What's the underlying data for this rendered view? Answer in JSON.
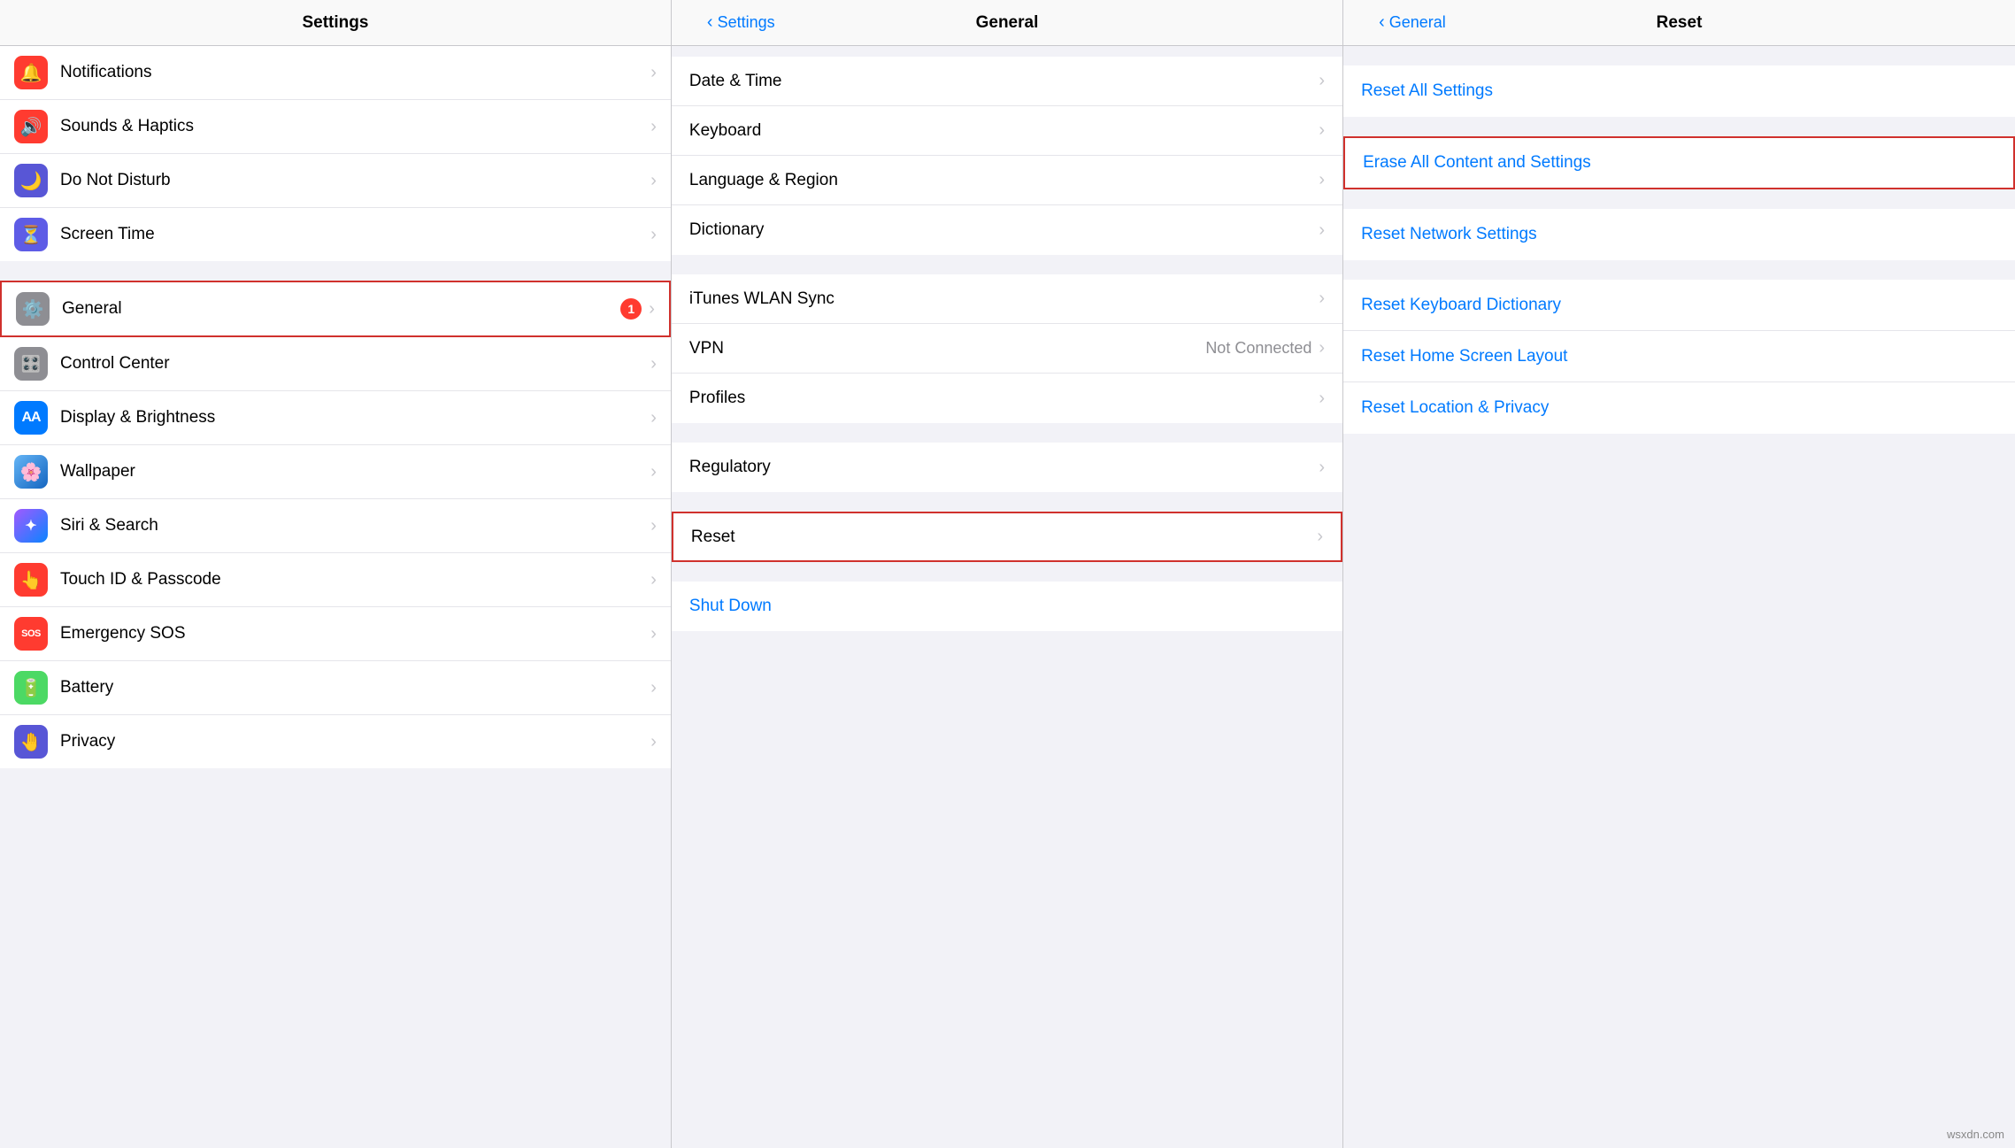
{
  "settings_col": {
    "header": "Settings",
    "items_group1": [
      {
        "id": "notifications",
        "label": "Notifications",
        "icon_bg": "#ff3b30",
        "icon": "🔔"
      },
      {
        "id": "sounds",
        "label": "Sounds & Haptics",
        "icon_bg": "#ff3b30",
        "icon": "🔊"
      },
      {
        "id": "donotdisturb",
        "label": "Do Not Disturb",
        "icon_bg": "#5856d6",
        "icon": "🌙"
      },
      {
        "id": "screentime",
        "label": "Screen Time",
        "icon_bg": "#5e5ce6",
        "icon": "⏳"
      }
    ],
    "items_group2": [
      {
        "id": "general",
        "label": "General",
        "icon_bg": "#8e8e93",
        "icon": "⚙️",
        "badge": "1",
        "highlighted": true
      },
      {
        "id": "controlcenter",
        "label": "Control Center",
        "icon_bg": "#8e8e93",
        "icon": "🎛️"
      },
      {
        "id": "displaybrightness",
        "label": "Display & Brightness",
        "icon_bg": "#007aff",
        "icon": "AA"
      },
      {
        "id": "wallpaper",
        "label": "Wallpaper",
        "icon_bg": "#34aadc",
        "icon": "🌸"
      },
      {
        "id": "sirisearch",
        "label": "Siri & Search",
        "icon_bg": "#000",
        "icon": "✦"
      },
      {
        "id": "touchid",
        "label": "Touch ID & Passcode",
        "icon_bg": "#ff3b30",
        "icon": "👆"
      },
      {
        "id": "emergencysos",
        "label": "Emergency SOS",
        "icon_bg": "#ff3b30",
        "icon": "SOS"
      },
      {
        "id": "battery",
        "label": "Battery",
        "icon_bg": "#4cd964",
        "icon": "🔋"
      },
      {
        "id": "privacy",
        "label": "Privacy",
        "icon_bg": "#5856d6",
        "icon": "🤚"
      }
    ]
  },
  "general_col": {
    "header": "General",
    "back_label": "Settings",
    "items_group1": [
      {
        "id": "datetime",
        "label": "Date & Time"
      },
      {
        "id": "keyboard",
        "label": "Keyboard"
      },
      {
        "id": "language",
        "label": "Language & Region"
      },
      {
        "id": "dictionary",
        "label": "Dictionary"
      }
    ],
    "items_group2": [
      {
        "id": "ituneswlan",
        "label": "iTunes WLAN Sync"
      },
      {
        "id": "vpn",
        "label": "VPN",
        "value": "Not Connected"
      },
      {
        "id": "profiles",
        "label": "Profiles"
      }
    ],
    "items_group3": [
      {
        "id": "regulatory",
        "label": "Regulatory"
      }
    ],
    "items_group4": [
      {
        "id": "reset",
        "label": "Reset",
        "highlighted": true
      }
    ],
    "shutdown_label": "Shut Down"
  },
  "reset_col": {
    "header": "Reset",
    "back_label": "General",
    "items_group1": [
      {
        "id": "reset-all-settings",
        "label": "Reset All Settings"
      }
    ],
    "items_group2": [
      {
        "id": "erase-all",
        "label": "Erase All Content and Settings",
        "highlighted": true
      }
    ],
    "items_group3": [
      {
        "id": "reset-network",
        "label": "Reset Network Settings"
      }
    ],
    "items_group4": [
      {
        "id": "reset-keyboard",
        "label": "Reset Keyboard Dictionary"
      },
      {
        "id": "reset-homescreen",
        "label": "Reset Home Screen Layout"
      },
      {
        "id": "reset-location",
        "label": "Reset Location & Privacy"
      }
    ]
  },
  "watermark": "wsxdn.com",
  "icons": {
    "chevron_right": "›",
    "chevron_back": "‹"
  }
}
